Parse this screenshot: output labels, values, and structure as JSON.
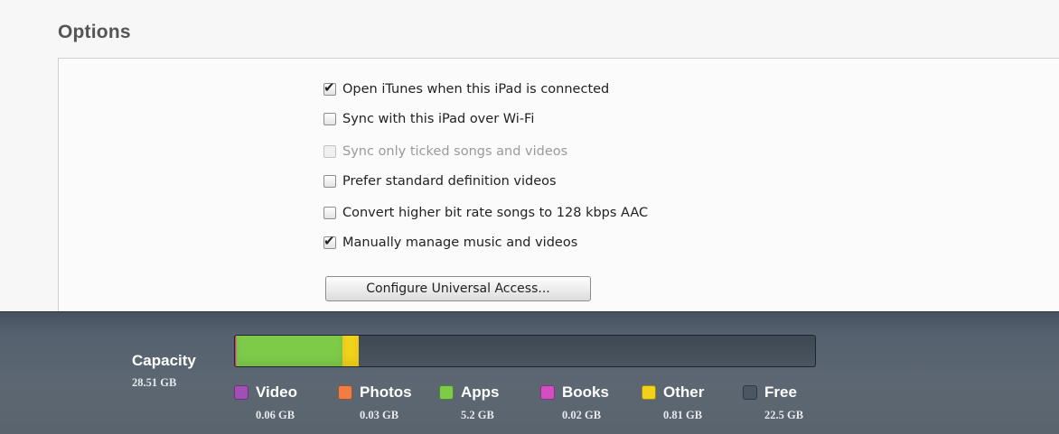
{
  "options": {
    "title": "Options",
    "items": [
      {
        "label": "Open iTunes when this iPad is connected",
        "checked": true,
        "enabled": true
      },
      {
        "label": "Sync with this iPad over Wi-Fi",
        "checked": false,
        "enabled": true
      },
      {
        "label": "Sync only ticked songs and videos",
        "checked": false,
        "enabled": false
      },
      {
        "label": "Prefer standard definition videos",
        "checked": false,
        "enabled": true
      },
      {
        "label": "Convert higher bit rate songs to 128 kbps AAC",
        "checked": false,
        "enabled": true
      },
      {
        "label": "Manually manage music and videos",
        "checked": true,
        "enabled": true
      }
    ],
    "configure_button": "Configure Universal Access..."
  },
  "capacity": {
    "label": "Capacity",
    "total": "28.51 GB",
    "categories": [
      {
        "name": "Video",
        "value": "0.06 GB",
        "gb": 0.06,
        "color": "#a14fb5"
      },
      {
        "name": "Photos",
        "value": "0.03 GB",
        "gb": 0.03,
        "color": "#ef7d45"
      },
      {
        "name": "Apps",
        "value": "5.2 GB",
        "gb": 5.2,
        "color": "#7ecb4a"
      },
      {
        "name": "Books",
        "value": "0.02 GB",
        "gb": 0.02,
        "color": "#d14fc0"
      },
      {
        "name": "Other",
        "value": "0.81 GB",
        "gb": 0.81,
        "color": "#f2d11c"
      },
      {
        "name": "Free",
        "value": "22.5 GB",
        "gb": 22.5,
        "color": "#4a5662"
      }
    ]
  }
}
